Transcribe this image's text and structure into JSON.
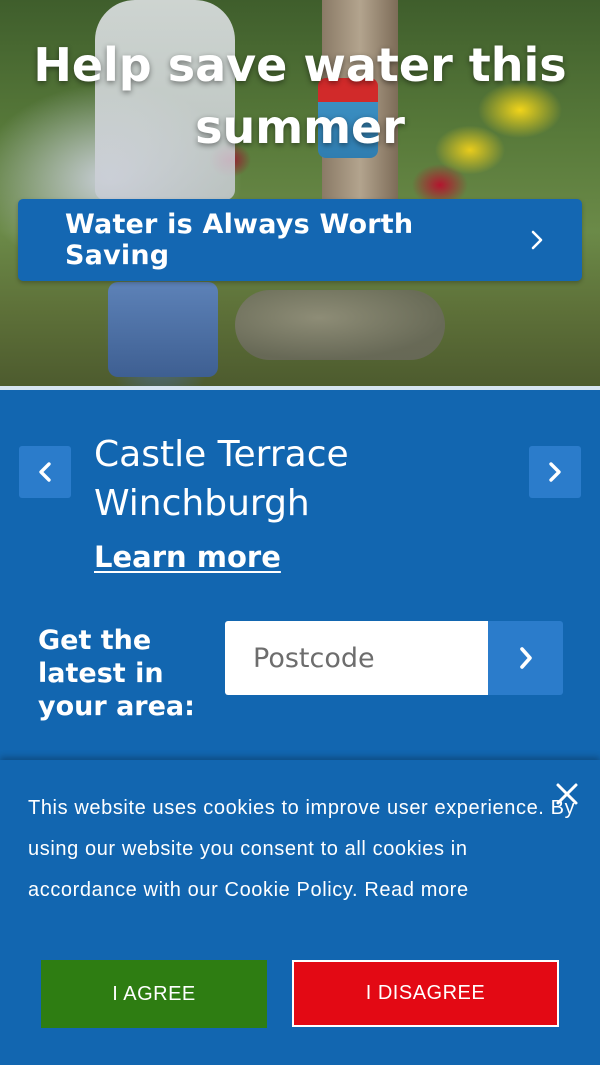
{
  "hero": {
    "title": "Help save water this summer",
    "cta_label": "Water is Always Worth Saving",
    "cta_icon": "chevron-right-icon"
  },
  "location_card": {
    "name": "Castle Terrace Winchburgh",
    "learn_more": "Learn more",
    "prev_icon": "chevron-left-icon",
    "next_icon": "chevron-right-icon"
  },
  "postcode_search": {
    "label": "Get the latest in your area:",
    "placeholder": "Postcode",
    "value": "",
    "submit_icon": "chevron-right-icon"
  },
  "cookie_banner": {
    "message": "This website uses cookies to improve user experience. By using our website you consent to all cookies in accordance with our Cookie Policy. Read more",
    "agree_label": "I AGREE",
    "disagree_label": "I DISAGREE",
    "close_icon": "close-icon"
  },
  "colors": {
    "primary_blue": "#1266b0",
    "button_blue": "#2b7ccb",
    "agree_green": "#2e7d12",
    "disagree_red": "#e30914"
  }
}
